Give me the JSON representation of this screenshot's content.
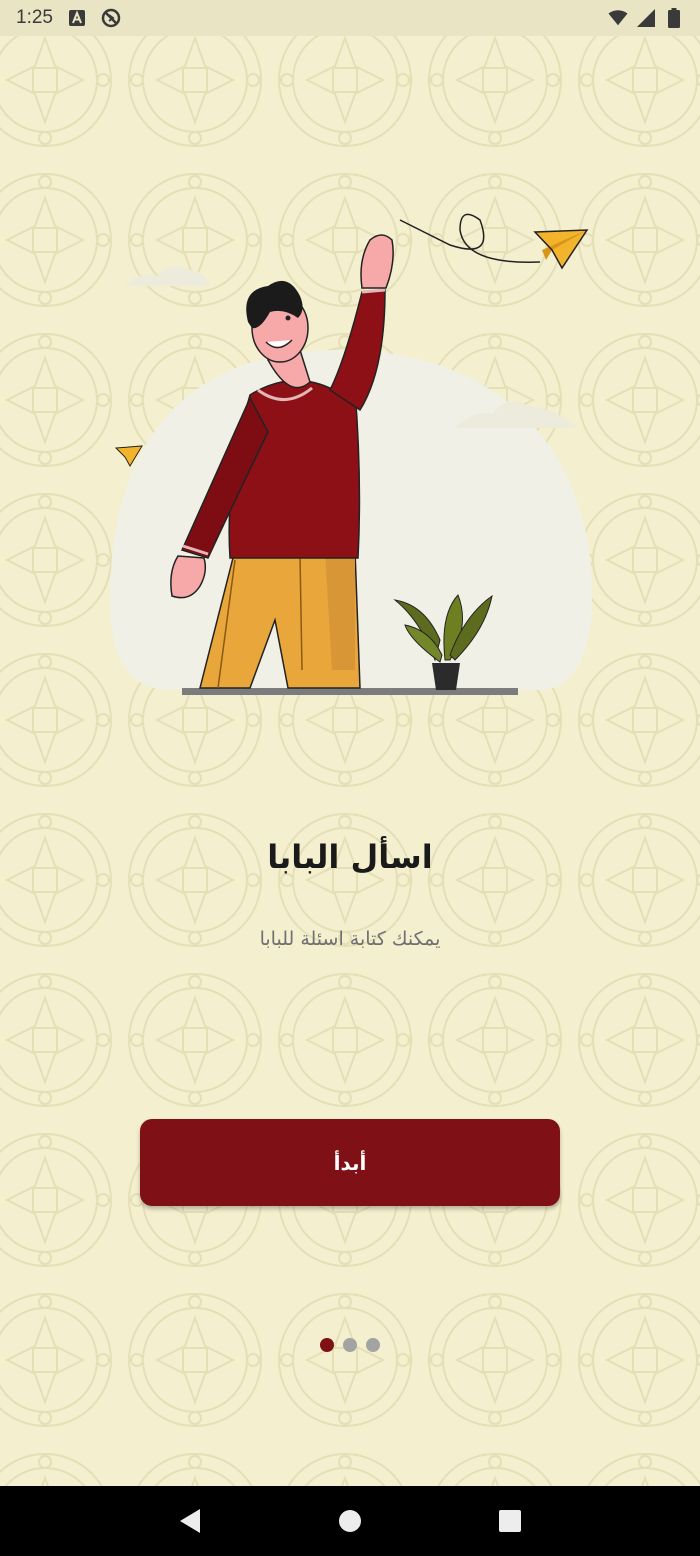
{
  "status_bar": {
    "time": "1:25",
    "icons": [
      "a-box-icon",
      "no-sync-icon",
      "wifi-icon",
      "signal-icon",
      "battery-icon"
    ]
  },
  "onboarding": {
    "title": "اسأل البابا",
    "subtitle": "يمكنك كتابة اسئلة للبابا",
    "start_button_label": "أبدأ",
    "page_indicator": {
      "total": 3,
      "active": 1
    }
  },
  "nav_bar": {
    "icons": [
      "back-icon",
      "home-icon",
      "recents-icon"
    ]
  },
  "colors": {
    "background": "#f3efcf",
    "accent": "#7e1016",
    "dot_inactive": "#a3a3a3"
  }
}
